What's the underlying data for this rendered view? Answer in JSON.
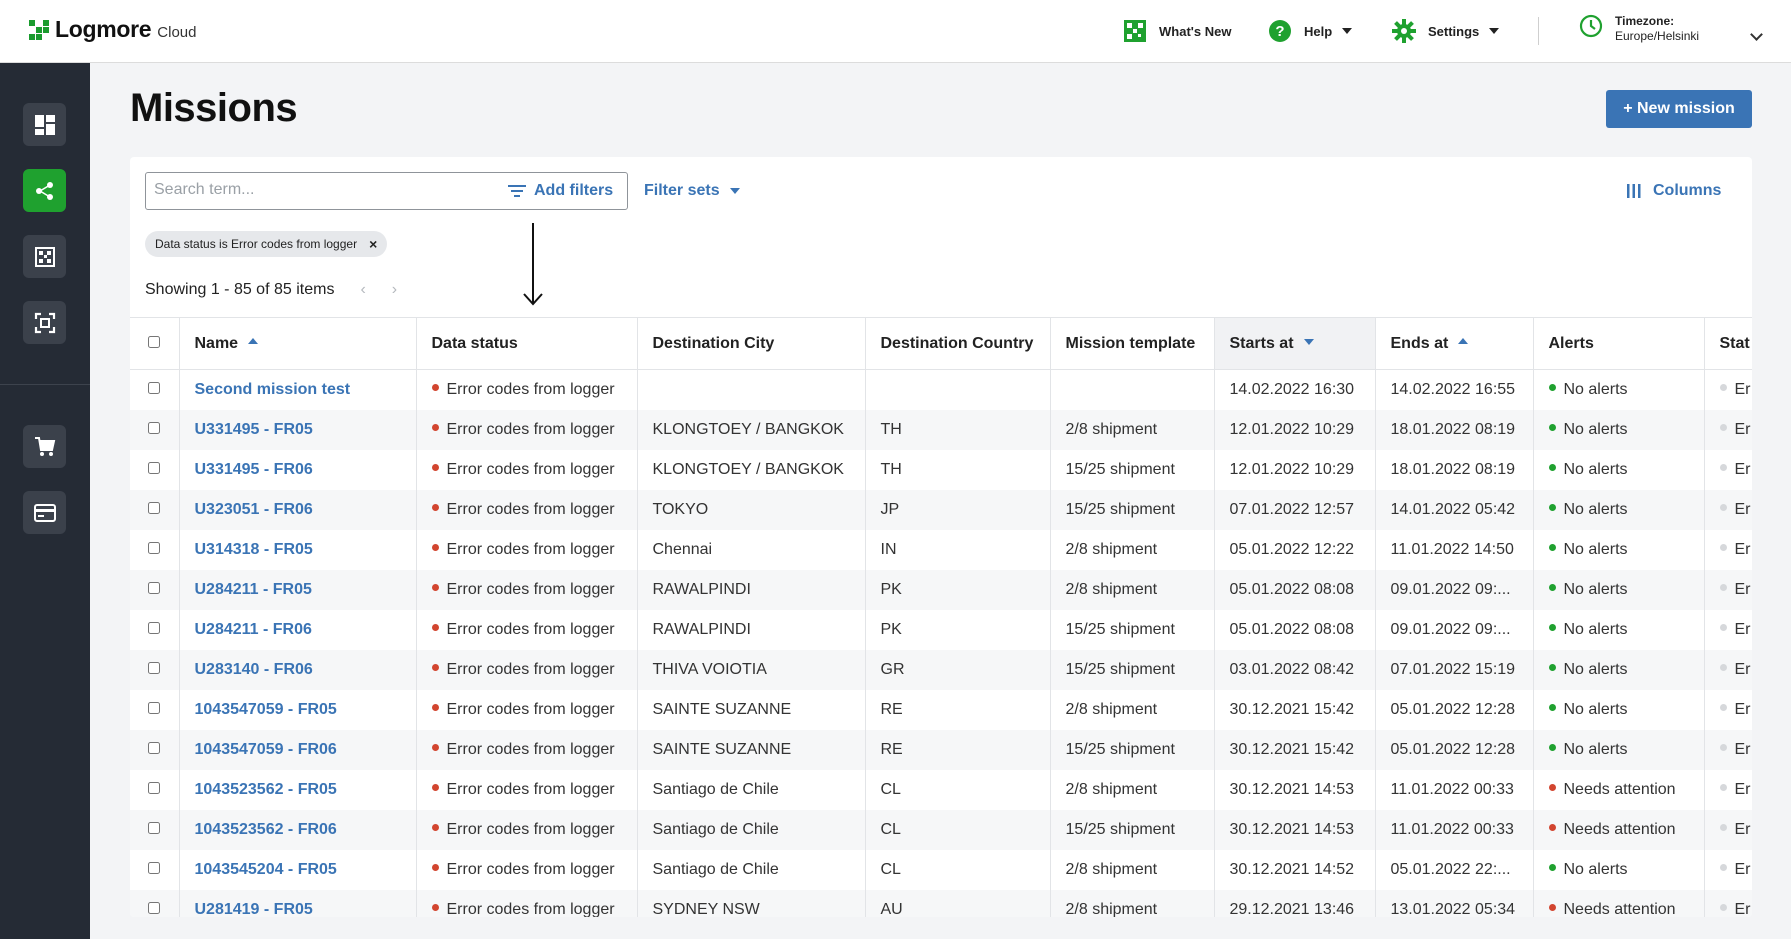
{
  "brand": {
    "name": "Logmore",
    "sub": "Cloud",
    "color": "#1a9b2e"
  },
  "topnav": {
    "whats_new": "What's New",
    "help": "Help",
    "settings": "Settings",
    "timezone_label": "Timezone:",
    "timezone_value": "Europe/Helsinki"
  },
  "sidebar": {
    "items": [
      {
        "icon": "dashboard-icon"
      },
      {
        "icon": "share-nodes-icon",
        "active": true
      },
      {
        "icon": "qr-code-icon"
      },
      {
        "icon": "scan-frame-icon"
      },
      {
        "icon": "cart-icon"
      },
      {
        "icon": "credit-card-icon"
      }
    ]
  },
  "page": {
    "title": "Missions",
    "new_button": "+ New mission"
  },
  "toolbar": {
    "search_placeholder": "Search term...",
    "add_filters": "Add filters",
    "filter_sets": "Filter sets",
    "columns": "Columns"
  },
  "filter_chip": {
    "label": "Data status is Error codes from logger",
    "remove": "×"
  },
  "pagination": {
    "showing": "Showing 1 - 85 of 85 items",
    "prev": "‹",
    "next": "›"
  },
  "table": {
    "headers": {
      "name": "Name",
      "data_status": "Data status",
      "dest_city": "Destination City",
      "dest_country": "Destination Country",
      "template": "Mission template",
      "starts_at": "Starts at",
      "ends_at": "Ends at",
      "alerts": "Alerts",
      "status": "Stat"
    },
    "rows": [
      {
        "name": "Second mission test",
        "data_status": "Error codes from logger",
        "city": "",
        "country": "",
        "template": "",
        "starts": "14.02.2022 16:30",
        "ends": "14.02.2022 16:55",
        "alerts": "No alerts",
        "alert_level": "green",
        "status": "Er"
      },
      {
        "name": "U331495 - FR05",
        "data_status": "Error codes from logger",
        "city": "KLONGTOEY / BANGKOK",
        "country": "TH",
        "template": "2/8 shipment",
        "starts": "12.01.2022 10:29",
        "ends": "18.01.2022 08:19",
        "alerts": "No alerts",
        "alert_level": "green",
        "status": "Er"
      },
      {
        "name": "U331495 - FR06",
        "data_status": "Error codes from logger",
        "city": "KLONGTOEY / BANGKOK",
        "country": "TH",
        "template": "15/25 shipment",
        "starts": "12.01.2022 10:29",
        "ends": "18.01.2022 08:19",
        "alerts": "No alerts",
        "alert_level": "green",
        "status": "Er"
      },
      {
        "name": "U323051 - FR06",
        "data_status": "Error codes from logger",
        "city": "TOKYO",
        "country": "JP",
        "template": "15/25 shipment",
        "starts": "07.01.2022 12:57",
        "ends": "14.01.2022 05:42",
        "alerts": "No alerts",
        "alert_level": "green",
        "status": "Er"
      },
      {
        "name": "U314318 - FR05",
        "data_status": "Error codes from logger",
        "city": "Chennai",
        "country": "IN",
        "template": "2/8 shipment",
        "starts": "05.01.2022 12:22",
        "ends": "11.01.2022 14:50",
        "alerts": "No alerts",
        "alert_level": "green",
        "status": "Er"
      },
      {
        "name": "U284211 - FR05",
        "data_status": "Error codes from logger",
        "city": "RAWALPINDI",
        "country": "PK",
        "template": "2/8 shipment",
        "starts": "05.01.2022 08:08",
        "ends": "09.01.2022 09:...",
        "alerts": "No alerts",
        "alert_level": "green",
        "status": "Er"
      },
      {
        "name": "U284211 - FR06",
        "data_status": "Error codes from logger",
        "city": "RAWALPINDI",
        "country": "PK",
        "template": "15/25 shipment",
        "starts": "05.01.2022 08:08",
        "ends": "09.01.2022 09:...",
        "alerts": "No alerts",
        "alert_level": "green",
        "status": "Er"
      },
      {
        "name": "U283140 - FR06",
        "data_status": "Error codes from logger",
        "city": "THIVA VOIOTIA",
        "country": "GR",
        "template": "15/25 shipment",
        "starts": "03.01.2022 08:42",
        "ends": "07.01.2022 15:19",
        "alerts": "No alerts",
        "alert_level": "green",
        "status": "Er"
      },
      {
        "name": "1043547059 - FR05",
        "data_status": "Error codes from logger",
        "city": "SAINTE SUZANNE",
        "country": "RE",
        "template": "2/8 shipment",
        "starts": "30.12.2021 15:42",
        "ends": "05.01.2022 12:28",
        "alerts": "No alerts",
        "alert_level": "green",
        "status": "Er"
      },
      {
        "name": "1043547059 - FR06",
        "data_status": "Error codes from logger",
        "city": "SAINTE SUZANNE",
        "country": "RE",
        "template": "15/25 shipment",
        "starts": "30.12.2021 15:42",
        "ends": "05.01.2022 12:28",
        "alerts": "No alerts",
        "alert_level": "green",
        "status": "Er"
      },
      {
        "name": "1043523562 - FR05",
        "data_status": "Error codes from logger",
        "city": "Santiago de Chile",
        "country": "CL",
        "template": "2/8 shipment",
        "starts": "30.12.2021 14:53",
        "ends": "11.01.2022 00:33",
        "alerts": "Needs attention",
        "alert_level": "red",
        "status": "Er"
      },
      {
        "name": "1043523562 - FR06",
        "data_status": "Error codes from logger",
        "city": "Santiago de Chile",
        "country": "CL",
        "template": "15/25 shipment",
        "starts": "30.12.2021 14:53",
        "ends": "11.01.2022 00:33",
        "alerts": "Needs attention",
        "alert_level": "red",
        "status": "Er"
      },
      {
        "name": "1043545204 - FR05",
        "data_status": "Error codes from logger",
        "city": "Santiago de Chile",
        "country": "CL",
        "template": "2/8 shipment",
        "starts": "30.12.2021 14:52",
        "ends": "05.01.2022 22:...",
        "alerts": "No alerts",
        "alert_level": "green",
        "status": "Er"
      },
      {
        "name": "U281419 - FR05",
        "data_status": "Error codes from logger",
        "city": "SYDNEY NSW",
        "country": "AU",
        "template": "2/8 shipment",
        "starts": "29.12.2021 13:46",
        "ends": "13.01.2022 05:34",
        "alerts": "Needs attention",
        "alert_level": "red",
        "status": "Er"
      }
    ]
  }
}
